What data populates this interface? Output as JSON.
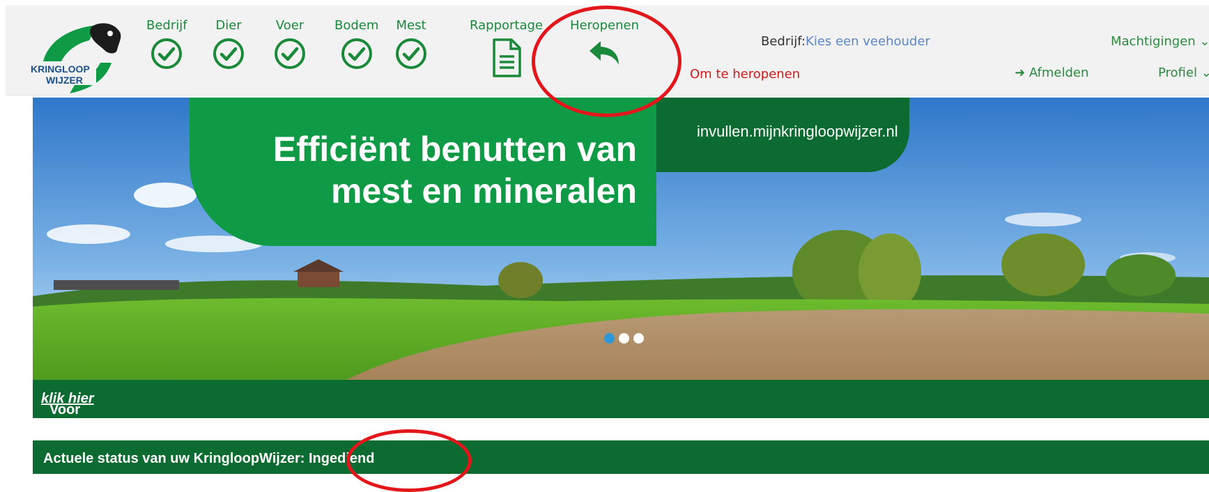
{
  "header": {
    "logo_text_line1": "KRINGLOOP",
    "logo_text_line2": "WIJZER",
    "steps": [
      {
        "label": "Bedrijf",
        "icon": "check-circle-icon"
      },
      {
        "label": "Dier",
        "icon": "check-circle-icon"
      },
      {
        "label": "Voer",
        "icon": "check-circle-icon"
      },
      {
        "label": "Bodem",
        "icon": "check-circle-icon"
      },
      {
        "label": "Mest",
        "icon": "check-circle-icon"
      },
      {
        "label": "Rapportage",
        "icon": "document-icon"
      },
      {
        "label": "Heropenen",
        "icon": "reply-arrow-icon"
      }
    ],
    "company_label": "Bedrijf:",
    "company_value": "Kies een veehouder",
    "reopen_note": "Om te heropenen",
    "permissions_label": "Machtigingen",
    "logout_label": "Afmelden",
    "profile_label": "Profiel"
  },
  "hero": {
    "headline_line1": "Efficiënt benutten van",
    "headline_line2": "mest en mineralen",
    "url": "invullen.mijnkringloopwijzer.nl",
    "slides_total": 3,
    "active_slide": 1
  },
  "notice_bar": {
    "text": "Voor actuele meldingen ",
    "link_text": "klik hier"
  },
  "status_bar": {
    "label": "Actuele status van uw KringloopWijzer: ",
    "value": "Ingediend"
  },
  "colors": {
    "brand_green": "#0f9a46",
    "dark_green": "#0b6b31",
    "link_blue": "#5b87c7",
    "annotation_red": "#e3161b"
  }
}
